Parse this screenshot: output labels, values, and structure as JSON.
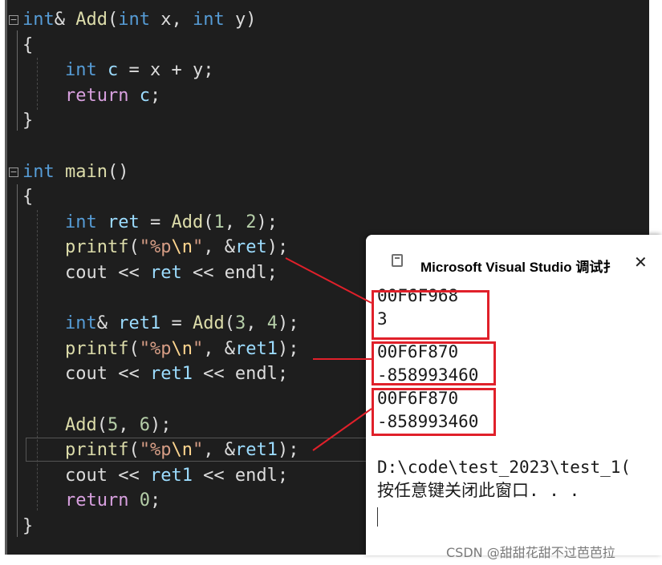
{
  "editor": {
    "lines": [
      [
        {
          "t": "int",
          "c": "kw"
        },
        {
          "t": "& ",
          "c": "pl"
        },
        {
          "t": "Add",
          "c": "fn"
        },
        {
          "t": "(",
          "c": "pl"
        },
        {
          "t": "int",
          "c": "kw"
        },
        {
          "t": " x, ",
          "c": "pl"
        },
        {
          "t": "int",
          "c": "kw"
        },
        {
          "t": " y)",
          "c": "pl"
        }
      ],
      [
        {
          "t": "{",
          "c": "pl"
        }
      ],
      [
        {
          "t": "    ",
          "c": "pl"
        },
        {
          "t": "int",
          "c": "kw"
        },
        {
          "t": " ",
          "c": "pl"
        },
        {
          "t": "c",
          "c": "var"
        },
        {
          "t": " = x + y;",
          "c": "pl"
        }
      ],
      [
        {
          "t": "    ",
          "c": "pl"
        },
        {
          "t": "return",
          "c": "ctl"
        },
        {
          "t": " ",
          "c": "pl"
        },
        {
          "t": "c",
          "c": "var"
        },
        {
          "t": ";",
          "c": "pl"
        }
      ],
      [
        {
          "t": "}",
          "c": "pl"
        }
      ],
      [],
      [
        {
          "t": "int",
          "c": "kw"
        },
        {
          "t": " ",
          "c": "pl"
        },
        {
          "t": "main",
          "c": "fn"
        },
        {
          "t": "()",
          "c": "pl"
        }
      ],
      [
        {
          "t": "{",
          "c": "pl"
        }
      ],
      [
        {
          "t": "    ",
          "c": "pl"
        },
        {
          "t": "int",
          "c": "kw"
        },
        {
          "t": " ",
          "c": "pl"
        },
        {
          "t": "ret",
          "c": "var"
        },
        {
          "t": " = ",
          "c": "pl"
        },
        {
          "t": "Add",
          "c": "fn"
        },
        {
          "t": "(",
          "c": "pl"
        },
        {
          "t": "1",
          "c": "num"
        },
        {
          "t": ", ",
          "c": "pl"
        },
        {
          "t": "2",
          "c": "num"
        },
        {
          "t": ");",
          "c": "pl"
        }
      ],
      [
        {
          "t": "    ",
          "c": "pl"
        },
        {
          "t": "printf",
          "c": "fn"
        },
        {
          "t": "(",
          "c": "pl"
        },
        {
          "t": "\"%p",
          "c": "str"
        },
        {
          "t": "\\n",
          "c": "esc"
        },
        {
          "t": "\"",
          "c": "str"
        },
        {
          "t": ", &",
          "c": "pl"
        },
        {
          "t": "ret",
          "c": "var"
        },
        {
          "t": ");",
          "c": "pl"
        }
      ],
      [
        {
          "t": "    cout << ",
          "c": "pl"
        },
        {
          "t": "ret",
          "c": "var"
        },
        {
          "t": " << endl;",
          "c": "pl"
        }
      ],
      [],
      [
        {
          "t": "    ",
          "c": "pl"
        },
        {
          "t": "int",
          "c": "kw"
        },
        {
          "t": "& ",
          "c": "pl"
        },
        {
          "t": "ret1",
          "c": "var"
        },
        {
          "t": " = ",
          "c": "pl"
        },
        {
          "t": "Add",
          "c": "fn"
        },
        {
          "t": "(",
          "c": "pl"
        },
        {
          "t": "3",
          "c": "num"
        },
        {
          "t": ", ",
          "c": "pl"
        },
        {
          "t": "4",
          "c": "num"
        },
        {
          "t": ");",
          "c": "pl"
        }
      ],
      [
        {
          "t": "    ",
          "c": "pl"
        },
        {
          "t": "printf",
          "c": "fn"
        },
        {
          "t": "(",
          "c": "pl"
        },
        {
          "t": "\"%p",
          "c": "str"
        },
        {
          "t": "\\n",
          "c": "esc"
        },
        {
          "t": "\"",
          "c": "str"
        },
        {
          "t": ", &",
          "c": "pl"
        },
        {
          "t": "ret1",
          "c": "var"
        },
        {
          "t": ");",
          "c": "pl"
        }
      ],
      [
        {
          "t": "    cout << ",
          "c": "pl"
        },
        {
          "t": "ret1",
          "c": "var"
        },
        {
          "t": " << endl;",
          "c": "pl"
        }
      ],
      [],
      [
        {
          "t": "    ",
          "c": "pl"
        },
        {
          "t": "Add",
          "c": "fn"
        },
        {
          "t": "(",
          "c": "pl"
        },
        {
          "t": "5",
          "c": "num"
        },
        {
          "t": ", ",
          "c": "pl"
        },
        {
          "t": "6",
          "c": "num"
        },
        {
          "t": ");",
          "c": "pl"
        }
      ],
      [
        {
          "t": "    ",
          "c": "pl"
        },
        {
          "t": "printf",
          "c": "fn"
        },
        {
          "t": "(",
          "c": "pl"
        },
        {
          "t": "\"%p",
          "c": "str"
        },
        {
          "t": "\\n",
          "c": "esc"
        },
        {
          "t": "\"",
          "c": "str"
        },
        {
          "t": ", &",
          "c": "pl"
        },
        {
          "t": "ret1",
          "c": "var"
        },
        {
          "t": ");",
          "c": "pl"
        }
      ],
      [
        {
          "t": "    cout << ",
          "c": "pl"
        },
        {
          "t": "ret1",
          "c": "var"
        },
        {
          "t": " << endl;",
          "c": "pl"
        }
      ],
      [
        {
          "t": "    ",
          "c": "pl"
        },
        {
          "t": "return",
          "c": "ctl"
        },
        {
          "t": " ",
          "c": "pl"
        },
        {
          "t": "0",
          "c": "num"
        },
        {
          "t": ";",
          "c": "pl"
        }
      ],
      [
        {
          "t": "}",
          "c": "pl"
        }
      ]
    ],
    "fold_glyph": "⊟"
  },
  "console": {
    "title": "Microsoft Visual Studio 调试扌",
    "close_glyph": "✕",
    "output": [
      "00F6F968",
      "3",
      "00F6F870",
      "-858993460",
      "00F6F870",
      "-858993460",
      "",
      "D:\\code\\test_2023\\test_1(",
      "按任意键关闭此窗口. . ."
    ]
  },
  "colors": {
    "editor_bg": "#1e1e1e",
    "annotation_red": "#e0202a",
    "keyword": "#569cd6",
    "control": "#d8a0df",
    "function": "#dcdcaa",
    "variable": "#9cdcfe",
    "number": "#b5cea8",
    "string": "#d69d85"
  },
  "watermark": "CSDN @甜甜花甜不过芭芭拉"
}
